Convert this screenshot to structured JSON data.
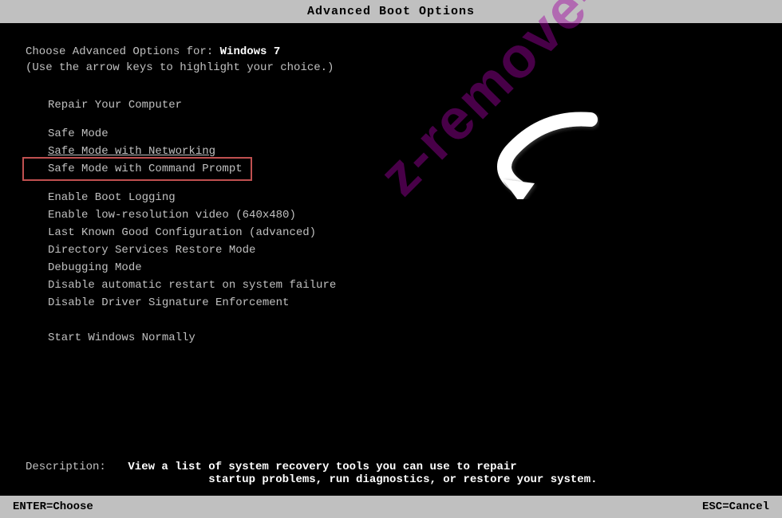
{
  "title_bar": {
    "label": "Advanced Boot Options"
  },
  "header": {
    "line1_prefix": "Choose Advanced Options for: ",
    "line1_os": "Windows 7",
    "line2": "(Use the arrow keys to highlight your choice.)"
  },
  "menu": {
    "items": [
      {
        "id": "repair",
        "label": "Repair Your Computer",
        "group": "top",
        "highlighted": false
      },
      {
        "id": "safe-mode",
        "label": "Safe Mode",
        "group": "safe",
        "highlighted": false
      },
      {
        "id": "safe-mode-networking",
        "label": "Safe Mode with Networking",
        "group": "safe",
        "highlighted": false
      },
      {
        "id": "safe-mode-cmd",
        "label": "Safe Mode with Command Prompt",
        "group": "safe",
        "highlighted": true
      },
      {
        "id": "enable-boot-logging",
        "label": "Enable Boot Logging",
        "group": "options",
        "highlighted": false
      },
      {
        "id": "low-res-video",
        "label": "Enable low-resolution video (640x480)",
        "group": "options",
        "highlighted": false
      },
      {
        "id": "last-known-good",
        "label": "Last Known Good Configuration (advanced)",
        "group": "options",
        "highlighted": false
      },
      {
        "id": "directory-services",
        "label": "Directory Services Restore Mode",
        "group": "options",
        "highlighted": false
      },
      {
        "id": "debugging-mode",
        "label": "Debugging Mode",
        "group": "options",
        "highlighted": false
      },
      {
        "id": "disable-restart",
        "label": "Disable automatic restart on system failure",
        "group": "options",
        "highlighted": false
      },
      {
        "id": "disable-driver-sig",
        "label": "Disable Driver Signature Enforcement",
        "group": "options",
        "highlighted": false
      }
    ],
    "start_normally": "Start Windows Normally"
  },
  "description": {
    "label": "Description:",
    "text": "View a list of system recovery tools you can use to repair\n            startup problems, run diagnostics, or restore your system."
  },
  "bottom_bar": {
    "left": "ENTER=Choose",
    "right": "ESC=Cancel"
  },
  "watermark": {
    "lines": [
      "z-remove-virus.com"
    ]
  }
}
